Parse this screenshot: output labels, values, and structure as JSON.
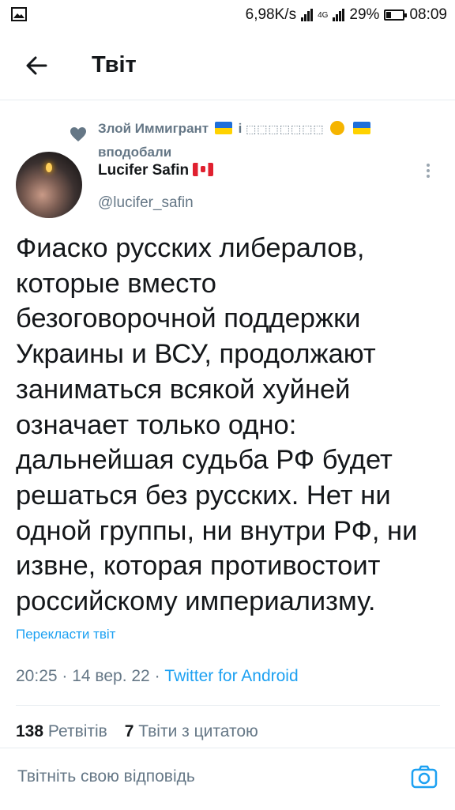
{
  "status_bar": {
    "speed": "6,98K/s",
    "lte": "4G",
    "battery": "29%",
    "battery_level": 0.29,
    "time": "08:09"
  },
  "header": {
    "title": "Твіт"
  },
  "liked_by": {
    "name": "Злой Иммигрант",
    "middle": "і",
    "hidden": "⬚⬚⬚⬚⬚⬚⬚",
    "suffix": "вподобали"
  },
  "author": {
    "name": "Lucifer Safin",
    "handle": "@lucifer_safin"
  },
  "tweet": {
    "text": "Фиаско русских либералов,\nкоторые вместо\nбезоговорочной поддержки\nУкраины и ВСУ, продолжают\nзаниматься всякой хуйней\nозначает только одно:\nдальнейшая судьба РФ будет\nрешаться без русских. Нет ни\nодной группы, ни внутри РФ, ни\nизвне, которая противостоит\nроссийскому империализму.",
    "translate_label": "Перекласти твіт",
    "time": "20:25",
    "date": "14 вер. 22",
    "app": "Twitter for Android"
  },
  "stats": {
    "retweets_count": "138",
    "retweets_label": "Ретвітів",
    "quotes_count": "7",
    "quotes_label": "Твіти з цитатою"
  },
  "reply": {
    "placeholder": "Твітніть свою відповідь"
  },
  "colors": {
    "accent": "#1da1f2",
    "secondary": "#657786",
    "text": "#14171a"
  }
}
